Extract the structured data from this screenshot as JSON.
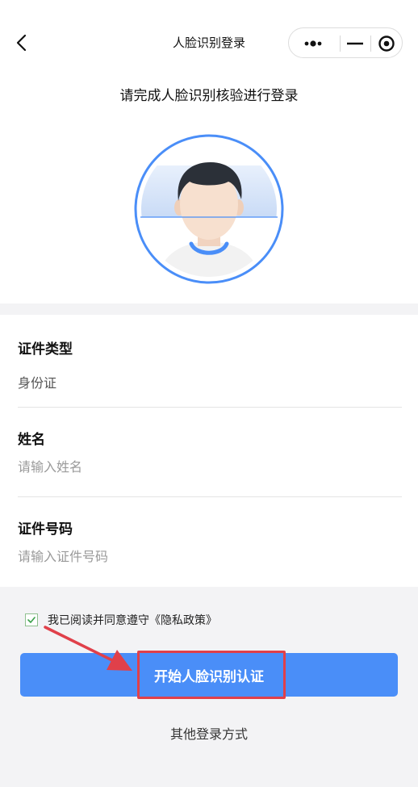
{
  "nav": {
    "title": "人脸识别登录",
    "back_icon": "chevron-left-icon",
    "capsule": {
      "more_icon": "more-dots-icon",
      "minimize_icon": "minimize-icon",
      "close_icon": "target-icon"
    }
  },
  "header": {
    "subtitle": "请完成人脸识别核验进行登录"
  },
  "face": {
    "icon": "face-avatar-icon",
    "accent": "#4a8ef8"
  },
  "form": {
    "id_type": {
      "label": "证件类型",
      "value": "身份证"
    },
    "name": {
      "label": "姓名",
      "placeholder": "请输入姓名"
    },
    "id_number": {
      "label": "证件号码",
      "placeholder": "请输入证件号码"
    }
  },
  "agreement": {
    "checked": true,
    "text": "我已阅读并同意遵守《隐私政策》"
  },
  "actions": {
    "start_label": "开始人脸识别认证",
    "other_login_label": "其他登录方式"
  },
  "annotation": {
    "color": "#e0404a"
  },
  "colors": {
    "primary": "#4a8ef8",
    "background": "#f3f3f5"
  }
}
